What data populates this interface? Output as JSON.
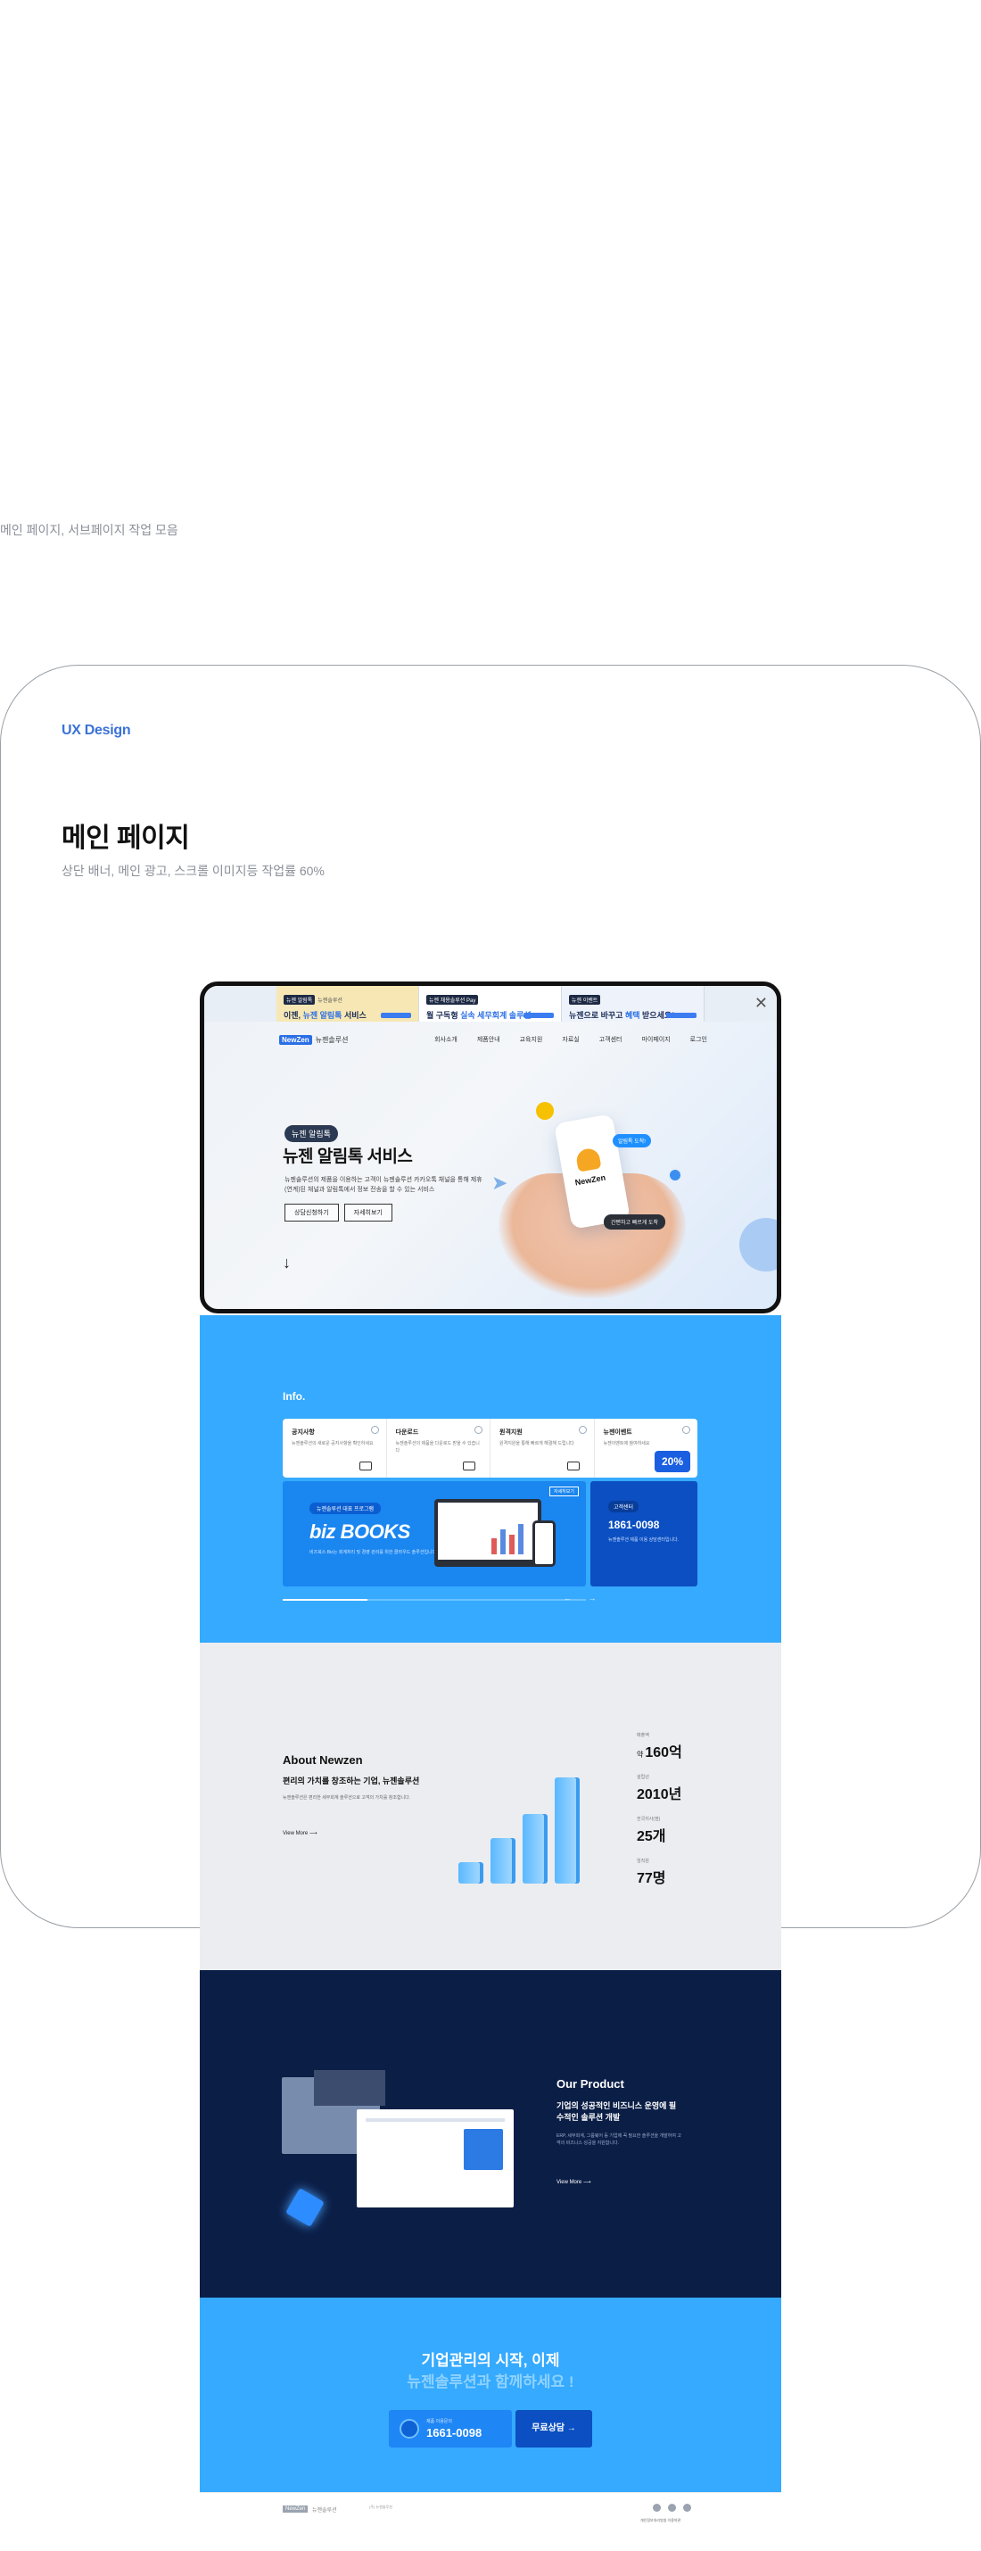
{
  "page": {
    "caption": "메인 페이지, 서브페이지 작업 모음",
    "kicker": "UX Design",
    "title": "메인 페이지",
    "subtitle": "상단 배너, 메인 광고, 스크롤 이미지등 작업률 60%"
  },
  "ads": [
    {
      "tag": "뉴젠 알림톡",
      "small": "뉴젠솔루션",
      "line_a": "이젠, ",
      "line_hl": "뉴젠 알림톡",
      "line_b": " 서비스"
    },
    {
      "tag": "뉴젠 채용솔루션 Pay",
      "small": "",
      "line_a": "월 구독형 ",
      "line_hl": "실속 세무회계 솔루션",
      "line_b": ""
    },
    {
      "tag": "뉴젠 이벤트",
      "small": "",
      "line_a": "뉴젠으로 바꾸고 ",
      "line_hl": "혜택",
      "line_b": " 받으세요!"
    }
  ],
  "ad_close": "✕",
  "nav": {
    "logo": "NewZen",
    "brand": "뉴젠솔루션",
    "menu": [
      "회사소개",
      "제품안내",
      "교육지원",
      "자료실",
      "고객센터",
      "마이페이지",
      "로그인"
    ]
  },
  "hero": {
    "badge": "뉴젠 알림톡",
    "title": "뉴젠 알림톡 서비스",
    "desc": "뉴젠솔루션의 제품을 이용하는 고객이 뉴젠솔루션 카카오톡 채널을 통해 제휴(연계)된 채널과 알림톡에서 정보 전송을 할 수 있는 서비스",
    "btn_consult": "상담신청하기",
    "btn_detail": "자세히보기",
    "arrow": "↓",
    "phone_name": "NewZen",
    "chip_blue": "알림톡 도착!",
    "chip_dark": "간편하고 빠르게 도착"
  },
  "info": {
    "title": "Info.",
    "cards": [
      {
        "title": "공지사항",
        "desc": "뉴젠솔루션의 새로운 공지사항을 확인하세요"
      },
      {
        "title": "다운로드",
        "desc": "뉴젠솔루션의 제품을 다운로드 받을 수 있습니다"
      },
      {
        "title": "원격지원",
        "desc": "원격지원을 통해 빠르게 해결해 드립니다"
      },
      {
        "title": "뉴젠이벤트",
        "desc": "뉴젠이벤트에 참여하세요"
      }
    ],
    "pct": "20%",
    "biz_chip": "뉴젠솔루션 대표 프로그램",
    "biz_title": "biz BOOKS",
    "biz_desc": "비즈북스 Biz는 회계처리 및 경영 관리를 위한 클라우드 솔루션입니다.",
    "biz_more": "자세히보기",
    "cs_chip": "고객센터",
    "cs_phone": "1861-0098",
    "cs_desc": "뉴젠솔루션 제품 이용 상담센터입니다.",
    "arrows": "← →"
  },
  "about": {
    "title": "About Newzen",
    "sub": "편리의 가치를 창조하는 기업, 뉴젠솔루션",
    "desc": "뉴젠솔루션은 편리한 세무회계 솔루션으로 고객의 가치를 창조합니다.",
    "more": "View More ⟶",
    "bars": [
      0.14,
      0.3,
      0.46,
      0.7
    ],
    "stats": [
      {
        "label": "매출액",
        "prefix": "약",
        "value": "160억"
      },
      {
        "label": "설립년",
        "prefix": "",
        "value": "2010년"
      },
      {
        "label": "전국지사(점)",
        "prefix": "",
        "value": "25개"
      },
      {
        "label": "임직원",
        "prefix": "",
        "value": "77명"
      }
    ]
  },
  "product": {
    "title": "Our Product",
    "sub": "기업의 성공적인 비즈니스 운영에 필수적인 솔루션 개발",
    "desc": "ERP, 세무회계, 그룹웨어 등 기업에 꼭 필요한 솔루션을 개발하여 고객의 비즈니스 성공을 지원합니다.",
    "more": "View More ⟶"
  },
  "cta": {
    "title": "기업관리의 시작, 이제",
    "sub": "뉴젠솔루션과 함께하세요 !",
    "call_label": "제품 이용문의",
    "call_number": "1661-0098",
    "free": "무료상담 →"
  },
  "footer": {
    "logo": "NewZen",
    "brand": "뉴젠솔루션",
    "info": "(주) 뉴젠솔루션",
    "links": "개인정보처리방침    이용약관"
  },
  "colors": {
    "accent": "#35aafe",
    "navy": "#0b1e46",
    "brand_blue": "#2b6fe6"
  }
}
